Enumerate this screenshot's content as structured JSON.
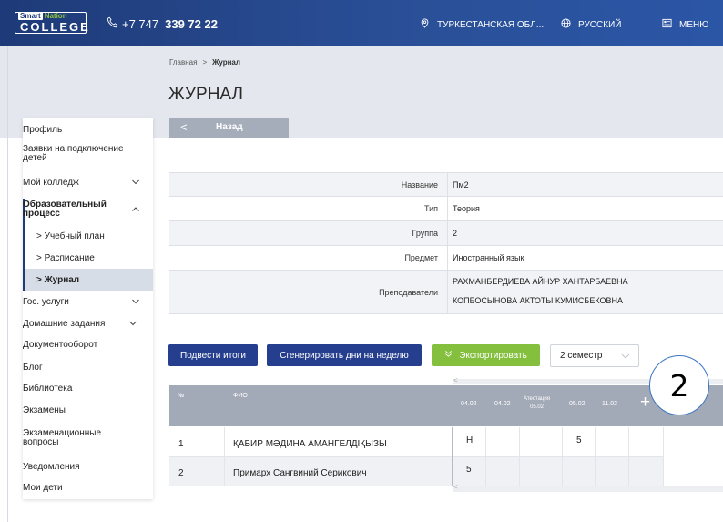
{
  "header": {
    "logo_top_a": "Smart",
    "logo_top_b": "Nation",
    "logo_main": "COLLEGE",
    "phone_prefix": "+7 747",
    "phone_number": "339 72 22",
    "region": "ТУРКЕСТАНСКАЯ ОБЛ...",
    "language": "РУССКИЙ",
    "menu": "МЕНЮ"
  },
  "breadcrumb": {
    "home": "Главная",
    "separator": ">",
    "current": "Журнал"
  },
  "page_title": "ЖУРНАЛ",
  "back_button": {
    "chevron": "<",
    "label": "Назад"
  },
  "sidebar": {
    "items": [
      {
        "label": "Профиль"
      },
      {
        "label": "Заявки на подключение детей"
      },
      {
        "label": "Мой колледж",
        "chevron": "down"
      },
      {
        "label": "Образовательный процесс",
        "chevron": "up"
      },
      {
        "label": "> Учебный план"
      },
      {
        "label": "> Расписание"
      },
      {
        "label": "> Журнал"
      },
      {
        "label": "Гос. услуги",
        "chevron": "down"
      },
      {
        "label": "Домашние задания",
        "chevron": "down"
      },
      {
        "label": "Документооборот"
      },
      {
        "label": "Блог"
      },
      {
        "label": "Библиотека"
      },
      {
        "label": "Экзамены"
      },
      {
        "label": "Экзаменационные вопросы"
      },
      {
        "label": "Уведомления"
      },
      {
        "label": "Мои дети"
      }
    ]
  },
  "info": {
    "name_label": "Название",
    "name_value": "Пм2",
    "type_label": "Тип",
    "type_value": "Теория",
    "group_label": "Группа",
    "group_value": "2",
    "subject_label": "Предмет",
    "subject_value": "Иностранный язык",
    "teachers_label": "Преподаватели",
    "teacher_1": "РАХМАНБЕРДИЕВА АЙНУР ХАНТАРБАЕВНА",
    "teacher_2": "КОПБОСЫНОВА АКТОТЫ КУМИСБЕКОВНА"
  },
  "actions": {
    "summarize": "Подвести итоги",
    "generate_days": "Сгенерировать дни на неделю",
    "export": "Экспортировать",
    "semester": "2 семестр"
  },
  "gradebook": {
    "col_num": "№",
    "col_fio": "ФИО",
    "dates": [
      "04.02",
      "04.02",
      "Атестация",
      "05.02",
      "11.02"
    ],
    "attestation_date": "05.02",
    "add_symbol": "+",
    "rows": [
      {
        "num": "1",
        "fio": "ҚАБИР МӘДИНА АМАНГЕЛДІҚЫЗЫ",
        "grades": [
          "Н",
          "",
          "",
          "5",
          ""
        ]
      },
      {
        "num": "2",
        "fio": "Примарх Сангвиний Серикович",
        "grades": [
          "5",
          "",
          "",
          "",
          ""
        ]
      }
    ],
    "scroll_left": "<",
    "scroll_right": ">"
  },
  "annotation_number": "2",
  "colors": {
    "primary": "#253f8e",
    "export_green": "#84bf3e",
    "header_bg": "#1e3a78",
    "table_head": "#a3aab7"
  }
}
